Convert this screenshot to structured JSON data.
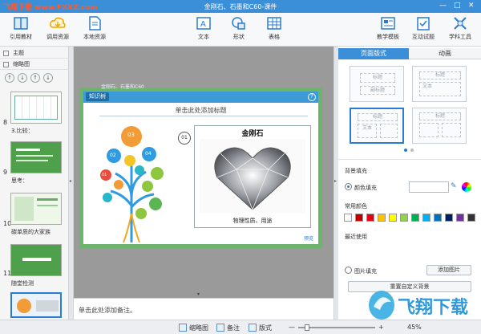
{
  "window": {
    "title": "金刚石、石墨和C60-课件",
    "watermark": "飞翔下载 www.FXXZ.com",
    "min_glyph": "—",
    "max_glyph": "□",
    "close_glyph": "✕"
  },
  "ribbon": {
    "buttons": [
      {
        "label": "引用教材",
        "icon": "book-icon"
      },
      {
        "label": "调用资源",
        "icon": "cloud-download-icon"
      },
      {
        "label": "本地资源",
        "icon": "file-icon"
      },
      {
        "label": "文本",
        "icon": "text-icon"
      },
      {
        "label": "形状",
        "icon": "shape-icon"
      },
      {
        "label": "表格",
        "icon": "table-icon"
      },
      {
        "label": "教学模板",
        "icon": "template-icon"
      },
      {
        "label": "互动试题",
        "icon": "quiz-icon"
      },
      {
        "label": "学科工具",
        "icon": "tools-icon"
      }
    ]
  },
  "left_pane": {
    "theme_label": "主题",
    "thumbnail_label": "缩略图",
    "nav_buttons": [
      "↑",
      "↓",
      "↑",
      "↓"
    ],
    "slides": [
      {
        "num": "8",
        "caption": "3.比较："
      },
      {
        "num": "9",
        "caption": "思考："
      },
      {
        "num": "10",
        "caption": "碳单质的大家族"
      },
      {
        "num": "11",
        "caption": "随堂检测"
      }
    ]
  },
  "slide": {
    "breadcrumb": "金刚石、石墨和C60",
    "section_badge": "知识树",
    "title_placeholder": "单击此处添加标题",
    "help_glyph": "?",
    "tree_nodes": [
      "01",
      "02",
      "03",
      "04"
    ],
    "step_badge": "01",
    "card_title": "金刚石",
    "card_caption": "物理性质、用途",
    "preview_label": "预览"
  },
  "notes": {
    "placeholder": "单击此处添加备注。"
  },
  "right_pane": {
    "tabs": [
      "页面版式",
      "动画"
    ],
    "layouts": [
      {
        "title": "标题",
        "sub": "副标题"
      },
      {
        "title": "标题",
        "sub": "文本"
      },
      {
        "title": "标题",
        "sub": "文本"
      },
      {
        "title": "标题",
        "sub": ""
      }
    ],
    "background_fill_label": "背景填充",
    "color_fill_label": "颜色填充",
    "common_colors_label": "常用颜色",
    "recent_label": "最近使用",
    "picture_fill_label": "图片填充",
    "add_picture_label": "添加图片",
    "reset_bg_label": "重置自定义背景",
    "swatches": [
      "#ffffff",
      "#c00000",
      "#e60012",
      "#ffc000",
      "#ffff00",
      "#92d050",
      "#00b050",
      "#00b0f0",
      "#0070c0",
      "#002060",
      "#7030a0",
      "#333333"
    ]
  },
  "status_bar": {
    "thumbnail": "缩略图",
    "notes": "备注",
    "layout": "版式",
    "zoom": "45%"
  },
  "colors": {
    "titlebar": "#3b8fd9",
    "accent": "#2a7bd4",
    "slide_border": "#6db56d"
  }
}
